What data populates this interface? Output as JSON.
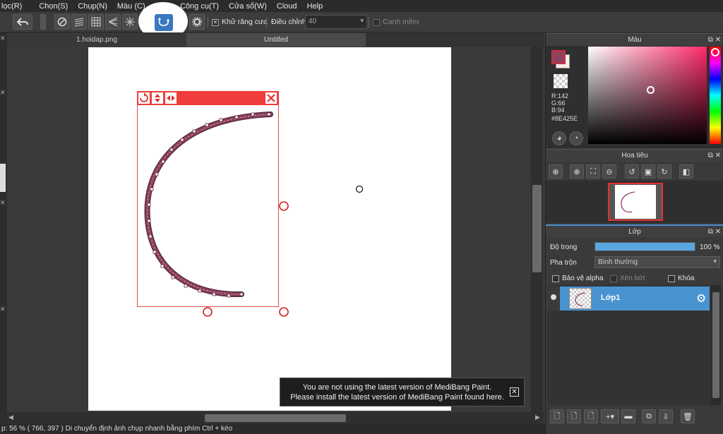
{
  "menu": [
    "lọc(R)",
    "Chọn(S)",
    "Chụp(N)",
    "Màu (C)",
    "V",
    "Công cụ(T)",
    "Cửa sổ(W)",
    "Cloud",
    "Help"
  ],
  "toolbar": {
    "antialias_label": "Khử răng cưa",
    "adjust_label": "Điều chỉnh",
    "adjust_value": "40",
    "soft_edge_label": "Cạnh mềm"
  },
  "tabs": [
    "1.hoidap.png",
    "Untitled"
  ],
  "color_panel": {
    "title": "Màu",
    "r": "R:142",
    "g": "G:66",
    "b": "B:94",
    "hex": "#8E425E",
    "current_color": "#8E425E"
  },
  "navigator_panel": {
    "title": "Hoa tiêu"
  },
  "layer_panel": {
    "title": "Lớp",
    "opacity_label": "Độ trong",
    "opacity_value": "100 %",
    "opacity_fraction": 1.0,
    "blend_label": "Pha trộn",
    "blend_value": "Bình thường",
    "protect_alpha_label": "Bảo vệ alpha",
    "clip_label": "Xén bớt",
    "lock_label": "Khóa",
    "layer_name": "Lớp1"
  },
  "notification": {
    "line1": "You are not using the latest version of MediBang Paint.",
    "line2": "Please install the latest version of MediBang Paint found here."
  },
  "status": {
    "text": "p: 56 %   ( 766, 397 )   Di chuyển định ảnh chụp nhanh bằng phím Ctrl + kéo"
  }
}
